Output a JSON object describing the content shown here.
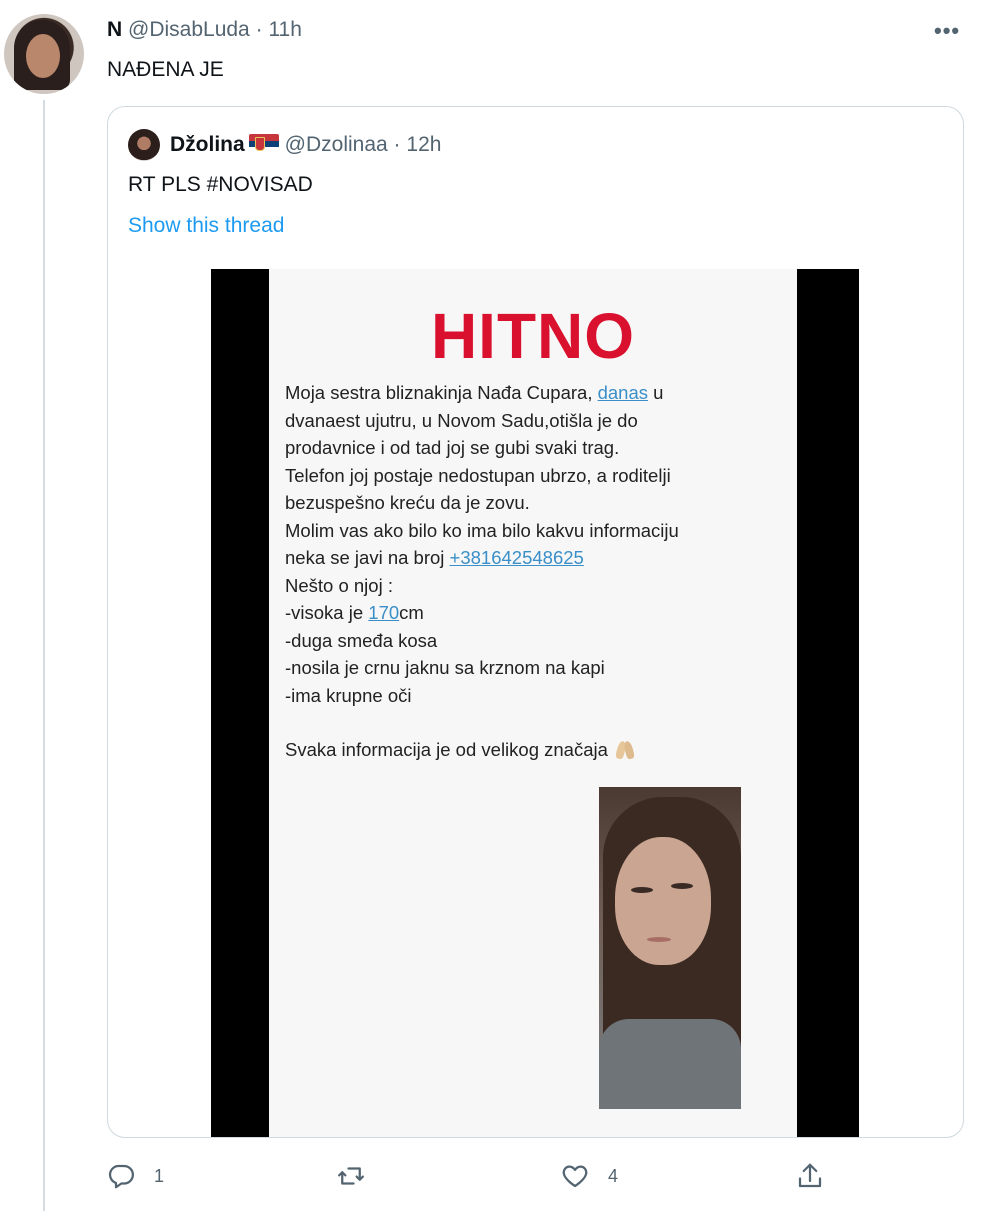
{
  "tweet": {
    "display_name": "N",
    "handle": "@DisabLuda",
    "separator": "·",
    "time": "11h",
    "text": "NAĐENA JE",
    "more_label": "•••"
  },
  "quote": {
    "display_name": "Džolina",
    "handle": "@Dzolinaa",
    "separator": "·",
    "time": "12h",
    "text": "RT PLS #NOVISAD",
    "show_thread": "Show this thread"
  },
  "poster": {
    "title": "HITNO",
    "line1_pre": "Moja sestra bliznakinja Nađa Cupara, ",
    "line1_link": "danas",
    "line1_post": " u",
    "line2": "dvanaest ujutru, u Novom Sadu,otišla je do",
    "line3": "prodavnice i od tad joj se gubi svaki trag.",
    "line4": "Telefon joj postaje nedostupan ubrzo, a roditelji",
    "line5": "bezuspešno kreću da je zovu.",
    "line6": "Molim vas ako bilo ko ima bilo kakvu informaciju",
    "line7_pre": "neka se javi na broj ",
    "line7_link": "+381642548625",
    "line8": "Nešto o njoj :",
    "line9_pre": "-visoka je ",
    "line9_link": "170",
    "line9_post": "cm",
    "line10": "-duga smeđa kosa",
    "line11": "-nosila je crnu jaknu sa krznom na kapi",
    "line12": "-ima krupne oči",
    "line13": "Svaka informacija je od velikog značaja"
  },
  "actions": {
    "reply_count": "1",
    "retweet_count": "",
    "like_count": "4"
  },
  "colors": {
    "link": "#1d9bf0",
    "hitno": "#d9102e",
    "muted": "#536471"
  }
}
